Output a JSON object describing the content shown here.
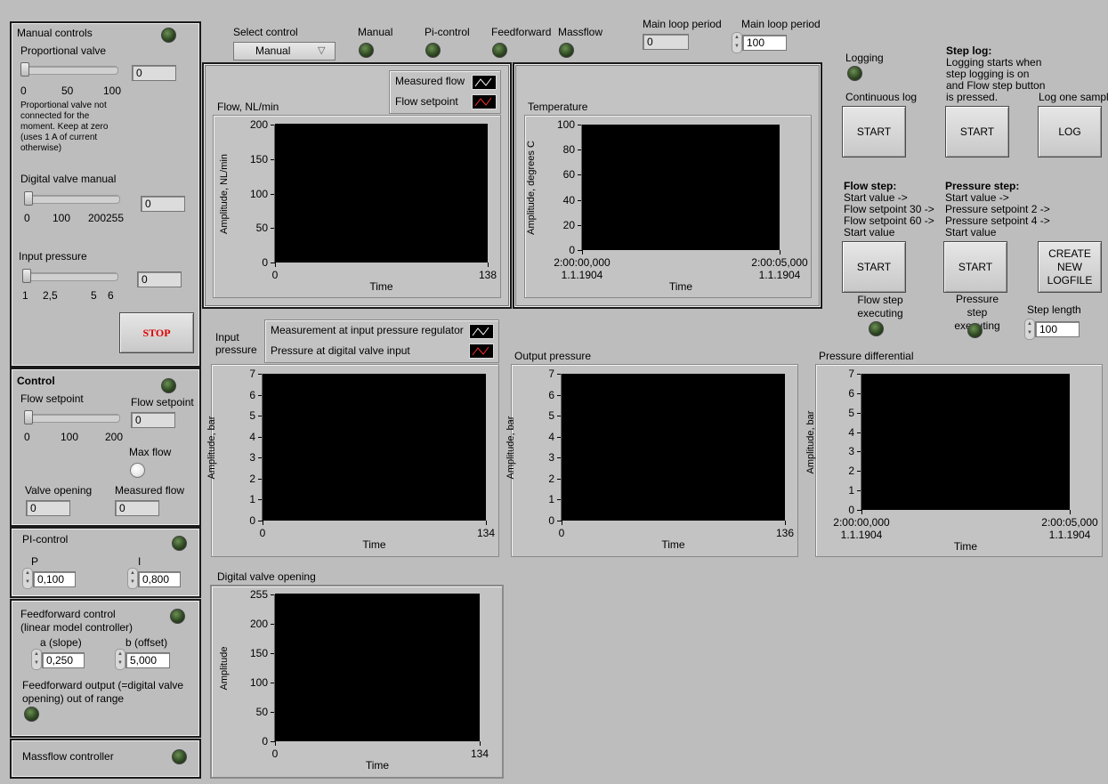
{
  "manual": {
    "title": "Manual controls",
    "prop_valve": {
      "label": "Proportional valve",
      "value": "0",
      "ticks": [
        "0",
        "50",
        "100"
      ],
      "note": "Proportional valve not connected for the moment. Keep at zero (uses 1 A of current otherwise)"
    },
    "dig_valve": {
      "label": "Digital valve manual",
      "value": "0",
      "ticks": [
        "0",
        "100",
        "200",
        "255"
      ]
    },
    "input_pressure": {
      "label": "Input pressure",
      "value": "0",
      "ticks": [
        "1",
        "2,5",
        "5",
        "6"
      ]
    },
    "stop_label": "STOP"
  },
  "control": {
    "title": "Control",
    "flow_setpoint_slider_label": "Flow setpoint",
    "flow_setpoint_ticks": [
      "0",
      "100",
      "200"
    ],
    "flow_setpoint_label": "Flow setpoint",
    "flow_setpoint_value": "0",
    "max_flow_label": "Max flow",
    "valve_opening_label": "Valve opening",
    "valve_opening_value": "0",
    "measured_flow_label": "Measured flow",
    "measured_flow_value": "0"
  },
  "pi": {
    "title": "PI-control",
    "p_label": "P",
    "p_value": "0,100",
    "i_label": "I",
    "i_value": "0,800"
  },
  "ff": {
    "title": "Feedforward control",
    "subtitle": "(linear model controller)",
    "a_label": "a (slope)",
    "a_value": "0,250",
    "b_label": "b (offset)",
    "b_value": "5,000",
    "range_label": "Feedforward output (=digital valve opening) out of range"
  },
  "massflow": {
    "title": "Massflow controller"
  },
  "top": {
    "select_label": "Select control",
    "select_value": "Manual",
    "ind_manual": "Manual",
    "ind_pi": "Pi-control",
    "ind_ff": "Feedforward",
    "ind_mass": "Massflow",
    "loop_label_1": "Main loop period",
    "loop_value_1": "0",
    "loop_label_2": "Main loop period",
    "loop_value_2": "100"
  },
  "flow_chart": {
    "title": "Flow, NL/min",
    "legend": [
      "Measured flow",
      "Flow setpoint"
    ],
    "ylabel": "Amplitude, NL/min",
    "xlabel": "Time",
    "yticks": [
      "200",
      "150",
      "100",
      "50",
      "0"
    ],
    "xticks": [
      "0",
      "138"
    ]
  },
  "temp_chart": {
    "title": "Temperature",
    "ylabel": "Amplitude, degrees C",
    "xlabel": "Time",
    "yticks": [
      "100",
      "80",
      "60",
      "40",
      "20",
      "0"
    ],
    "xticks": [
      "2:00:00,000",
      "2:00:05,000"
    ],
    "xdates": [
      "1.1.1904",
      "1.1.1904"
    ]
  },
  "input_chart": {
    "title": "Input pressure",
    "legend": [
      "Measurement at input pressure regulator",
      "Pressure at digital valve input"
    ],
    "ylabel": "Amplitude, bar",
    "xlabel": "Time",
    "yticks": [
      "7",
      "6",
      "5",
      "4",
      "3",
      "2",
      "1",
      "0"
    ],
    "xticks": [
      "0",
      "134"
    ]
  },
  "output_chart": {
    "title": "Output pressure",
    "ylabel": "Amplitude, bar",
    "xlabel": "Time",
    "yticks": [
      "7",
      "6",
      "5",
      "4",
      "3",
      "2",
      "1",
      "0"
    ],
    "xticks": [
      "0",
      "136"
    ]
  },
  "diff_chart": {
    "title": "Pressure differential",
    "ylabel": "Amplitude, bar",
    "xlabel": "Time",
    "yticks": [
      "7",
      "6",
      "5",
      "4",
      "3",
      "2",
      "1",
      "0"
    ],
    "xticks": [
      "2:00:00,000",
      "2:00:05,000"
    ],
    "xdates": [
      "1.1.1904",
      "1.1.1904"
    ]
  },
  "dv_chart": {
    "title": "Digital valve opening",
    "ylabel": "Amplitude",
    "xlabel": "Time",
    "yticks": [
      "255",
      "200",
      "150",
      "100",
      "50",
      "0"
    ],
    "xticks": [
      "0",
      "134"
    ]
  },
  "logging": {
    "logging_label": "Logging",
    "cont_label": "Continuous log",
    "start_label": "START",
    "step_log_title": "Step log:",
    "step_log_text": "Logging starts when step logging is on and Flow step button is pressed.",
    "log_one_label": "Log one sample",
    "log_label": "LOG",
    "flow_step_title": "Flow step:",
    "flow_step_lines": [
      "Start value ->",
      "Flow setpoint 30 ->",
      "Flow setpoint 60 ->",
      "Start value"
    ],
    "pressure_step_title": "Pressure step:",
    "pressure_step_lines": [
      "Start value ->",
      "Pressure setpoint 2 ->",
      "Pressure setpoint 4 ->",
      "Start value"
    ],
    "create_label": "CREATE NEW LOGFILE",
    "flow_exec_label": "Flow step executing",
    "pressure_exec_label": "Pressure step executing",
    "step_length_label": "Step length",
    "step_length_value": "100"
  }
}
